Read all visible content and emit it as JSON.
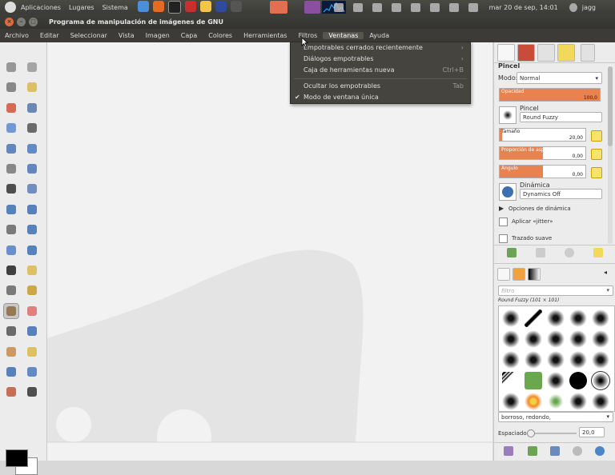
{
  "top_panel": {
    "menus": [
      "Aplicaciones",
      "Lugares",
      "Sistema"
    ],
    "clock": "mar 20 de sep, 14:01",
    "user": "jagg"
  },
  "window": {
    "title": "Programa de manipulación de imágenes de GNU"
  },
  "menubar": {
    "items": [
      "Archivo",
      "Editar",
      "Seleccionar",
      "Vista",
      "Imagen",
      "Capa",
      "Colores",
      "Herramientas",
      "Filtros",
      "Ventanas",
      "Ayuda"
    ],
    "active": "Ventanas"
  },
  "windows_menu": {
    "items": [
      {
        "label": "Empotrables cerrados recientemente",
        "accel": "›"
      },
      {
        "label": "Diálogos empotrables",
        "accel": "›"
      },
      {
        "label": "Caja de herramientas nueva",
        "accel": "Ctrl+B"
      },
      {
        "label": "Ocultar los empotrables",
        "accel": "Tab"
      },
      {
        "label": "Modo de ventana única",
        "accel": "",
        "checked": true
      }
    ],
    "check_glyph": "✔"
  },
  "tool_options": {
    "title": "Pincel",
    "mode_label": "Modo:",
    "mode_value": "Normal",
    "opacity": {
      "label": "Opacidad",
      "value": "100,0",
      "fraction": 1.0
    },
    "brush_label": "Pincel",
    "brush_value": "Round Fuzzy",
    "size": {
      "label": "Tamaño",
      "value": "20,00",
      "fraction": 0.05
    },
    "aspect": {
      "label": "Proporción de aspecto",
      "value": "0,00",
      "fraction": 0.5
    },
    "angle": {
      "label": "Ángulo",
      "value": "0,00",
      "fraction": 0.5
    },
    "dynamics_label": "Dinámica",
    "dynamics_value": "Dynamics Off",
    "dynamics_options": "Opciones de dinámica",
    "jitter": "Aplicar «jitter»",
    "smooth": "Trazado suave"
  },
  "brushes": {
    "filter_placeholder": "filtro",
    "current": "Round Fuzzy (101 × 101)",
    "tag_value": "borroso, redondo,",
    "spacing_label": "Espaciado:",
    "spacing_value": "20,0"
  },
  "colors": {
    "accent": "#e9824f",
    "panel": "#3c3b37",
    "canvas": "#f2f2f2"
  }
}
